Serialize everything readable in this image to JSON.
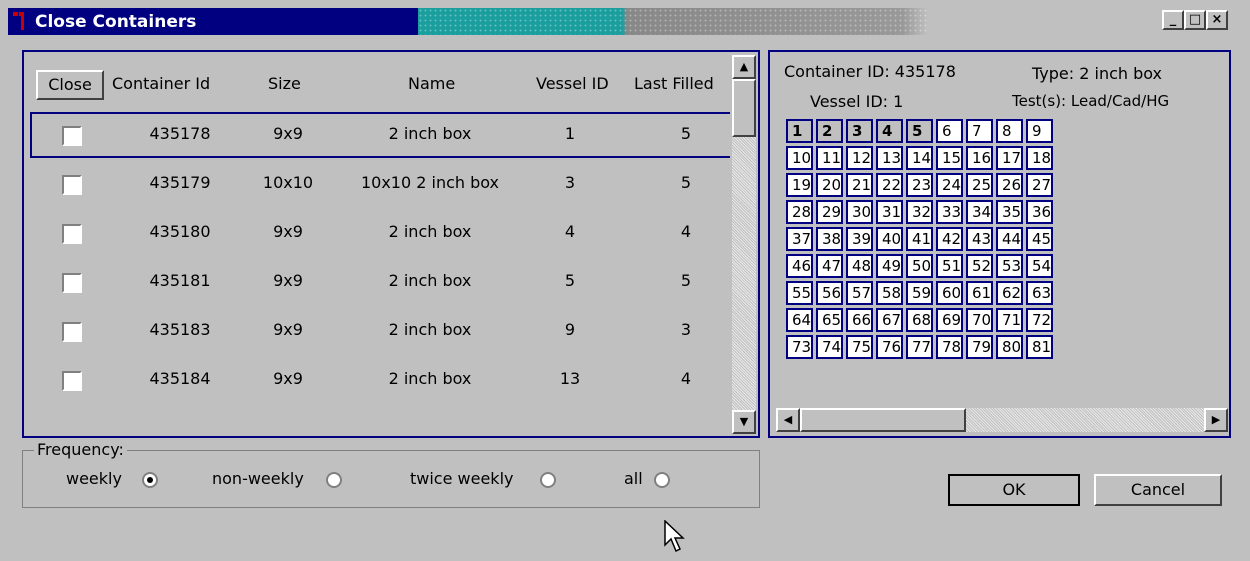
{
  "window": {
    "title": "Close Containers",
    "controls": [
      "_",
      "□",
      "×"
    ]
  },
  "table": {
    "close_button": "Close",
    "headers": [
      "Container Id",
      "Size",
      "Name",
      "Vessel ID",
      "Last Filled"
    ],
    "rows": [
      {
        "container_id": "435178",
        "size": "9x9",
        "name": "2 inch box",
        "vessel_id": "1",
        "last_filled": "5",
        "checked": false,
        "selected": true
      },
      {
        "container_id": "435179",
        "size": "10x10",
        "name": "10x10 2 inch box",
        "vessel_id": "3",
        "last_filled": "5",
        "checked": false,
        "selected": false
      },
      {
        "container_id": "435180",
        "size": "9x9",
        "name": "2 inch box",
        "vessel_id": "4",
        "last_filled": "4",
        "checked": false,
        "selected": false
      },
      {
        "container_id": "435181",
        "size": "9x9",
        "name": "2 inch box",
        "vessel_id": "5",
        "last_filled": "5",
        "checked": false,
        "selected": false
      },
      {
        "container_id": "435183",
        "size": "9x9",
        "name": "2 inch box",
        "vessel_id": "9",
        "last_filled": "3",
        "checked": false,
        "selected": false
      },
      {
        "container_id": "435184",
        "size": "9x9",
        "name": "2 inch box",
        "vessel_id": "13",
        "last_filled": "4",
        "checked": false,
        "selected": false
      }
    ]
  },
  "frequency": {
    "legend": "Frequency:",
    "options": [
      {
        "label": "weekly",
        "selected": true
      },
      {
        "label": "non-weekly",
        "selected": false
      },
      {
        "label": "twice weekly",
        "selected": false
      },
      {
        "label": "all",
        "selected": false
      }
    ]
  },
  "detail": {
    "container_id_label": "Container ID: 435178",
    "type_label": "Type: 2 inch box",
    "vessel_id_label": "Vessel ID: 1",
    "tests_label": "Test(s): Lead/Cad/HG",
    "filled_positions": 5,
    "grid_rows": [
      [
        "1",
        "2",
        "3",
        "4",
        "5",
        "6",
        "7",
        "8",
        "9"
      ],
      [
        "10",
        "11",
        "12",
        "13",
        "14",
        "15",
        "16",
        "17",
        "18"
      ],
      [
        "19",
        "20",
        "21",
        "22",
        "23",
        "24",
        "25",
        "26",
        "27"
      ],
      [
        "28",
        "29",
        "30",
        "31",
        "32",
        "33",
        "34",
        "35",
        "36"
      ],
      [
        "37",
        "38",
        "39",
        "40",
        "41",
        "42",
        "43",
        "44",
        "45"
      ],
      [
        "46",
        "47",
        "48",
        "49",
        "50",
        "51",
        "52",
        "53",
        "54"
      ],
      [
        "55",
        "56",
        "57",
        "58",
        "59",
        "60",
        "61",
        "62",
        "63"
      ],
      [
        "64",
        "65",
        "66",
        "67",
        "68",
        "69",
        "70",
        "71",
        "72"
      ],
      [
        "73",
        "74",
        "75",
        "76",
        "77",
        "78",
        "79",
        "80",
        "81"
      ]
    ]
  },
  "buttons": {
    "ok": "OK",
    "cancel": "Cancel"
  },
  "colors": {
    "title_bar": "#000080",
    "window_bg": "#c0c0c0",
    "grid_border": "#000080"
  }
}
